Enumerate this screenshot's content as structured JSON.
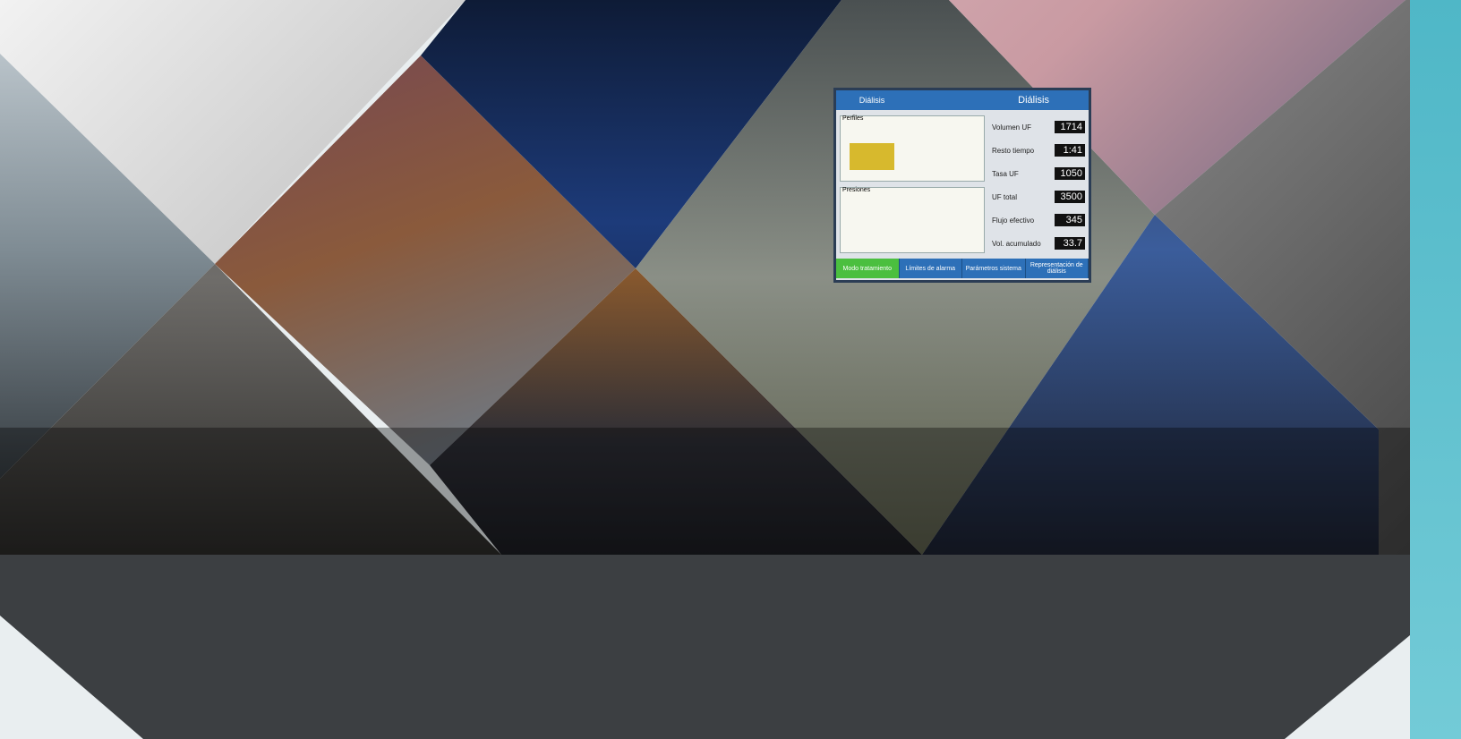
{
  "monitor": {
    "tab_label": "Diálisis",
    "title": "Diálisis",
    "values": [
      {
        "label": "Volumen UF",
        "value": "1714"
      },
      {
        "label": "Resto tiempo",
        "value": "1:41"
      },
      {
        "label": "Tasa UF",
        "value": "1050"
      },
      {
        "label": "UF total",
        "value": "3500"
      },
      {
        "label": "Flujo efectivo",
        "value": "345"
      },
      {
        "label": "Vol. acumulado",
        "value": "33.7"
      }
    ],
    "graph_labels": {
      "top": "Perfiles",
      "bottom": "Presiones"
    },
    "buttons": [
      {
        "label": "Modo tratamiento"
      },
      {
        "label": "Límites de alarma"
      },
      {
        "label": "Parámetros sistema"
      },
      {
        "label": "Representación de diálisis"
      }
    ]
  },
  "colors": {
    "panel": "#3c3f42",
    "teal": "#56bac8",
    "screen_accent": "#2d70b8"
  }
}
